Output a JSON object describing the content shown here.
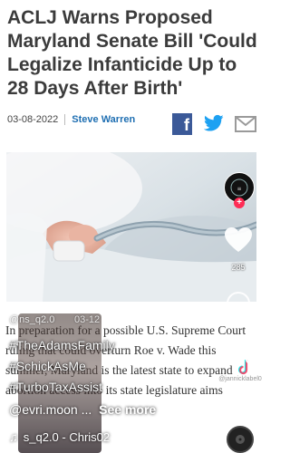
{
  "article": {
    "headline": "ACLJ Warns Proposed Maryland Senate Bill 'Could Legalize Infanticide Up to 28 Days After Birth'",
    "date": "03-08-2022",
    "author": "Steve Warren",
    "body": "In preparation for a possible U.S. Supreme Court ruling that could overturn Roe v. Wade this summer, Maryland is the latest state to expand abortion access into its state legislature aims"
  },
  "share": {
    "facebook_icon": "facebook-icon",
    "twitter_icon": "twitter-icon",
    "mail_icon": "mail-icon"
  },
  "tiktok": {
    "like_count": "285",
    "username": "@ns_q2.0",
    "post_date": "03-12",
    "tags": [
      "#TheAdamsFamily",
      "#SchickAsMe",
      "#TurboTaxAssist"
    ],
    "mention": "@evri.moon ...",
    "see_more": "See more",
    "music": "s_q2.0 - Chris02",
    "watermark_handle": "@jannicklabel0"
  },
  "colors": {
    "headline": "#3b3b3b",
    "author": "#1f6fb2",
    "facebook": "#3b5998",
    "twitter": "#1da1f2",
    "tiktok_accent": "#fe2c55"
  }
}
